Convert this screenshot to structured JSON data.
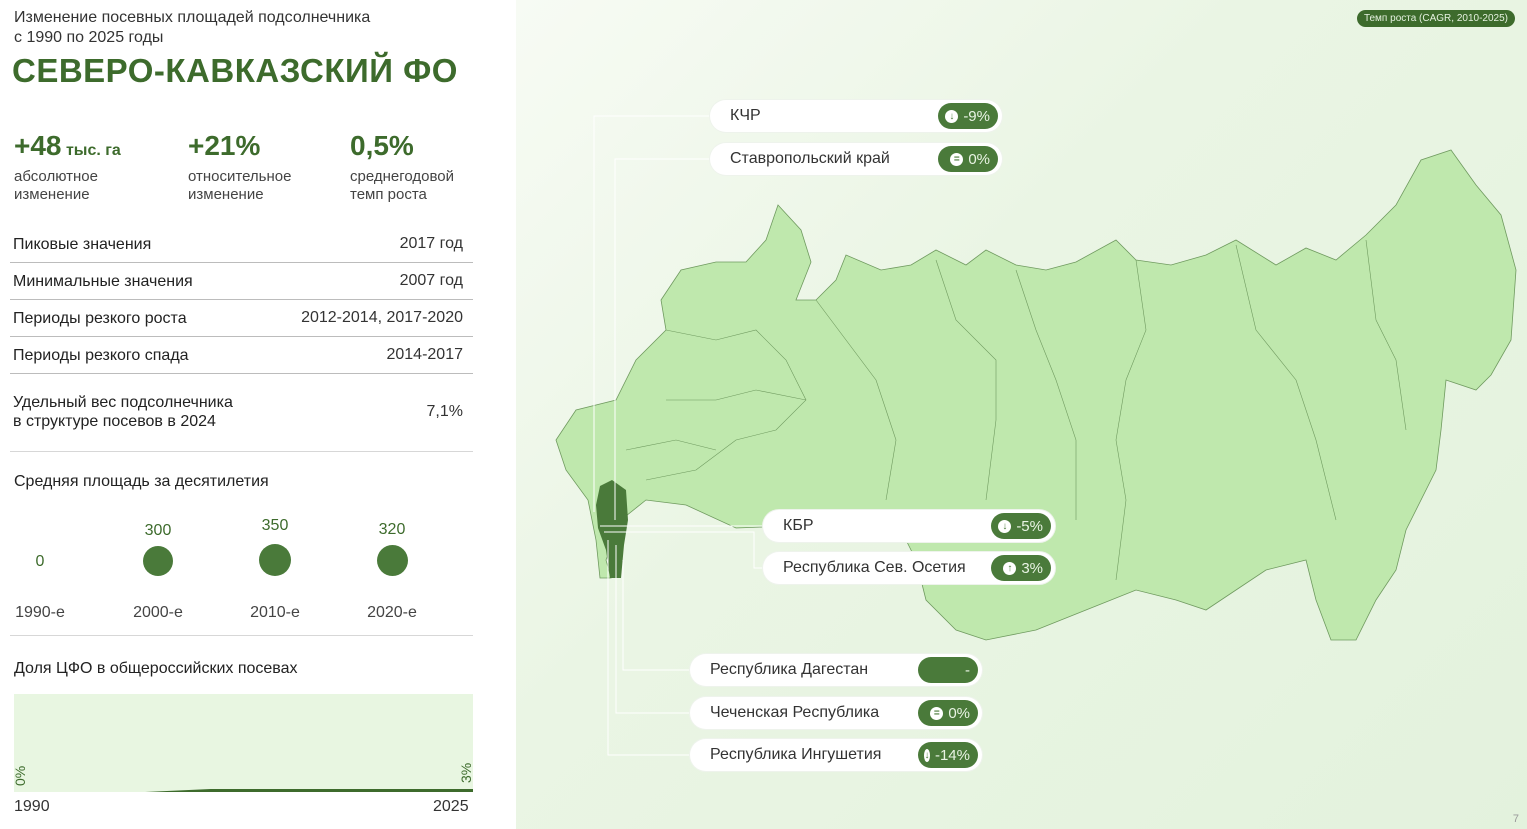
{
  "header": {
    "subtitle": "Изменение посевных площадей подсолнечника\nс 1990 по 2025 годы",
    "region": "СЕВЕРО-КАВКАЗСКИЙ ФО"
  },
  "stats": [
    {
      "value": "+48",
      "unit": " тыс. га",
      "label": "абсолютное\nизменение"
    },
    {
      "value": "+21%",
      "unit": "",
      "label": "относительное\nизменение"
    },
    {
      "value": "0,5%",
      "unit": "",
      "label": "среднегодовой\nтемп роста"
    }
  ],
  "info": [
    {
      "key": "Пиковые значения",
      "value": "2017 год"
    },
    {
      "key": "Минимальные значения",
      "value": "2007 год"
    },
    {
      "key": "Периоды резкого роста",
      "value": "2012-2014, 2017-2020"
    },
    {
      "key": "Периоды резкого спада",
      "value": "2014-2017"
    },
    {
      "key": "Удельный вес подсолнечника\nв структуре посевов в 2024",
      "value": "7,1%"
    }
  ],
  "decades": {
    "title": "Средняя площадь за десятилетия",
    "items": [
      {
        "label": "1990-е",
        "value": "0"
      },
      {
        "label": "2000-е",
        "value": "300"
      },
      {
        "label": "2010-е",
        "value": "350"
      },
      {
        "label": "2020-е",
        "value": "320"
      }
    ]
  },
  "share": {
    "title": "Доля ЦФО в общероссийских посевах",
    "x_start": "1990",
    "x_end": "2025",
    "y_start_label": "0%",
    "y_end_label": "3%"
  },
  "map": {
    "legend": "Темп роста (CAGR, 2010-2025)",
    "page_number": "7",
    "regions": [
      {
        "name": "КЧР",
        "value": "-9%",
        "trend": "down"
      },
      {
        "name": "Ставропольский край",
        "value": "0%",
        "trend": "flat"
      },
      {
        "name": "КБР",
        "value": "-5%",
        "trend": "down"
      },
      {
        "name": "Республика Сев. Осетия",
        "value": "3%",
        "trend": "up"
      },
      {
        "name": "Республика Дагестан",
        "value": "-",
        "trend": "none"
      },
      {
        "name": "Чеченская Республика",
        "value": "0%",
        "trend": "flat"
      },
      {
        "name": "Республика Ингушетия",
        "value": "-14%",
        "trend": "down"
      }
    ]
  },
  "colors": {
    "accent": "#3d6b2c",
    "map_fill": "#bfe8ad",
    "map_highlight": "#4a7a3a",
    "chart_bg": "#e8f6e1"
  },
  "chart_data": {
    "type": "area",
    "title": "Доля ЦФО в общероссийских посевах",
    "x": [
      1990,
      2000,
      2005,
      2010,
      2015,
      2020,
      2025
    ],
    "series": [
      {
        "values": [
          0,
          0,
          3,
          3,
          3,
          3,
          3
        ]
      }
    ],
    "xlim": [
      1990,
      2025
    ],
    "ylim": [
      0,
      100
    ]
  }
}
